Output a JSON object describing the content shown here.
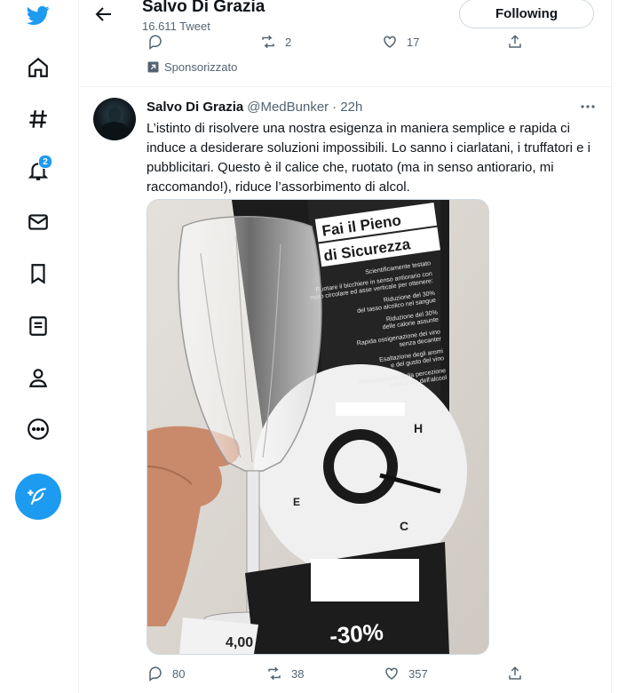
{
  "header": {
    "title": "Salvo Di Grazia",
    "subtitle": "16.611 Tweet",
    "follow_label": "Following"
  },
  "sidebar": {
    "items": [
      {
        "icon": "twitter-logo-icon"
      },
      {
        "icon": "home-icon"
      },
      {
        "icon": "explore-hashtag-icon"
      },
      {
        "icon": "notifications-bell-icon",
        "badge": "2"
      },
      {
        "icon": "messages-envelope-icon"
      },
      {
        "icon": "bookmarks-icon"
      },
      {
        "icon": "lists-icon"
      },
      {
        "icon": "profile-icon"
      },
      {
        "icon": "more-circle-icon"
      }
    ],
    "compose_icon": "compose-feather-icon"
  },
  "prev_tweet": {
    "actions": {
      "reply": "",
      "retweet": "2",
      "like": "17"
    },
    "promoted_label": "Sponsorizzato"
  },
  "tweet": {
    "author_name": "Salvo Di Grazia",
    "handle": "@MedBunker",
    "time": "· 22h",
    "text": "L’istinto di risolvere una nostra esigenza in maniera semplice e rapida ci induce a desiderare soluzioni impossibili. Lo sanno i ciarlatani, i truffatori e i pubblicitari. Questo è il calice che, ruotato (ma in senso antiorario, mi raccomando!), riduce l’assorbimento di alcol.",
    "media": {
      "box_title_1": "Fai il Pieno",
      "box_title_2": "di Sicurezza",
      "line_1": "Scientificamente testato",
      "line_2": "Ruotare il bicchiere in senso antiorario con",
      "line_3": "moto circolare ed asse verticale per ottenere:",
      "line_4": "Riduzione del 30%",
      "line_5": "del tasso alcolico nel sangue",
      "line_6": "Riduzione del 30%",
      "line_7": "delle calorie assunte",
      "line_8": "Rapida ossigenazione del vino",
      "line_9": "senza decanter",
      "line_10": "Esaltazione degli aromi",
      "line_11": "e del gusto del vino",
      "line_12": "Abbassamento della percezione",
      "line_13": "sensoriale dell'alcool",
      "gauge_h": "H",
      "gauge_e": "E",
      "gauge_c": "C",
      "discount": "-30%",
      "price": "4,00"
    },
    "actions": {
      "reply": "80",
      "retweet": "38",
      "like": "357"
    }
  },
  "colors": {
    "accent": "#1d9bf0",
    "text": "#0f1419",
    "muted": "#536471",
    "border": "#eff3f4"
  }
}
